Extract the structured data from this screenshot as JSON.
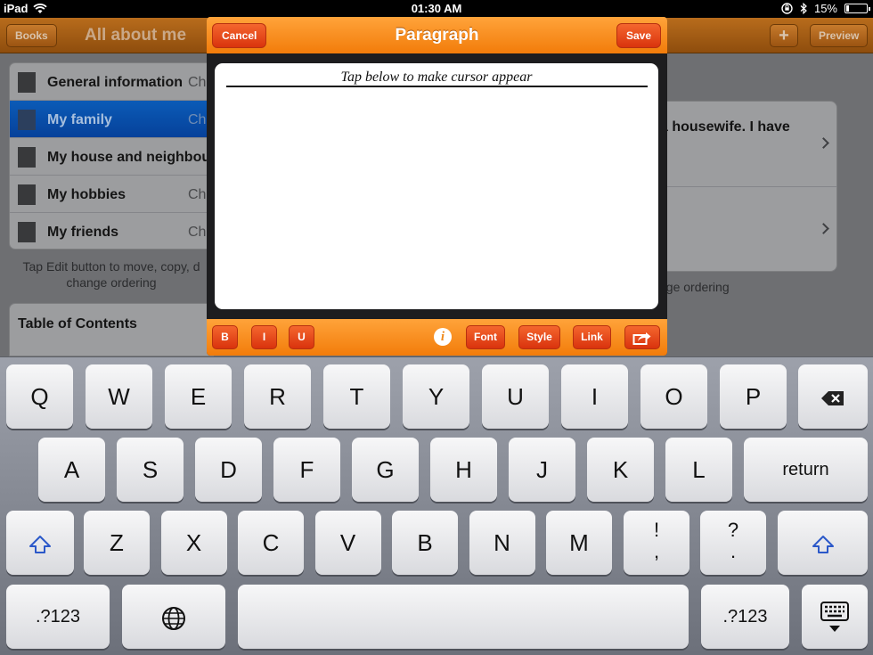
{
  "status_bar": {
    "device": "iPad",
    "time": "01:30 AM",
    "battery": "15%",
    "battery_level": 0.15
  },
  "background_app": {
    "nav": {
      "books_label": "Books",
      "title": "All about me",
      "add_label": "+",
      "preview_label": "Preview"
    },
    "list_items": [
      {
        "label": "General information",
        "sub": "Ch"
      },
      {
        "label": "My family",
        "sub": "Cha",
        "selected": true
      },
      {
        "label": "My house and neighbou",
        "sub": ""
      },
      {
        "label": "My hobbies",
        "sub": "Cha"
      },
      {
        "label": "My friends",
        "sub": "Cha"
      }
    ],
    "list_hint": "Tap Edit button to move, copy, d change ordering",
    "toc_label": "Table of Contents",
    "detail_text": "a housewife. I have",
    "detail_hint": "nge ordering"
  },
  "popover": {
    "title": "Paragraph",
    "cancel_label": "Cancel",
    "save_label": "Save",
    "editor_hint": "Tap below to make cursor appear",
    "toolbar": {
      "bold": "B",
      "italic": "I",
      "underline": "U",
      "info": "i",
      "font": "Font",
      "style": "Style",
      "link": "Link"
    }
  },
  "keyboard": {
    "row1": [
      "Q",
      "W",
      "E",
      "R",
      "T",
      "Y",
      "U",
      "I",
      "O",
      "P"
    ],
    "row2": [
      "A",
      "S",
      "D",
      "F",
      "G",
      "H",
      "J",
      "K",
      "L"
    ],
    "row3": [
      "Z",
      "X",
      "C",
      "V",
      "B",
      "N",
      "M"
    ],
    "return_label": "return",
    "punct1": [
      "!",
      ","
    ],
    "punct2": [
      "?",
      "."
    ],
    "numbers_label": ".?123"
  }
}
